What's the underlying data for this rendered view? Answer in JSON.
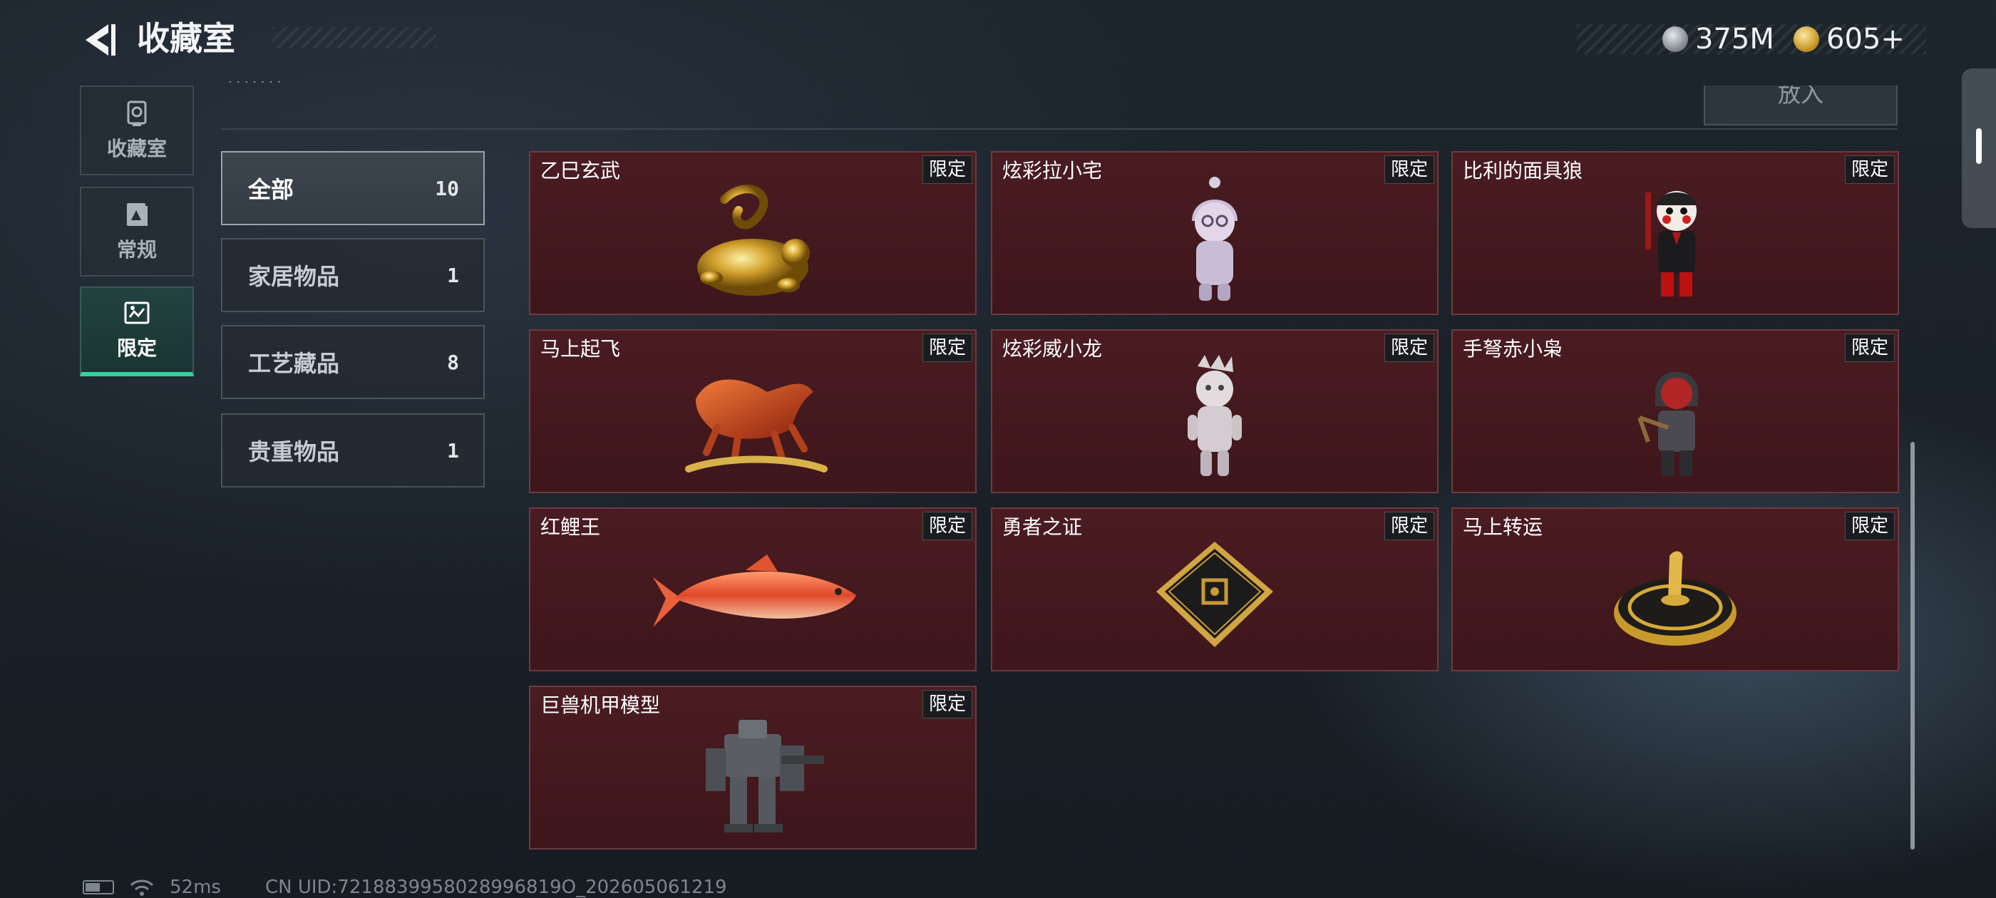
{
  "header": {
    "title": "收藏室",
    "currencies": [
      {
        "icon": "silver-coin-icon",
        "value": "375M",
        "color": "#b9c0c7"
      },
      {
        "icon": "gold-coin-icon",
        "value": "605+",
        "color": "#d6a53a"
      }
    ]
  },
  "nav": [
    {
      "label": "收藏室",
      "icon": "trophy-icon"
    },
    {
      "label": "常规",
      "icon": "document-icon"
    },
    {
      "label": "限定",
      "icon": "limited-icon",
      "active": true
    }
  ],
  "put_button_label": "放入",
  "categories": [
    {
      "label": "全部",
      "count": "10",
      "active": true
    },
    {
      "label": "家居物品",
      "count": "1"
    },
    {
      "label": "工艺藏品",
      "count": "8"
    },
    {
      "label": "贵重物品",
      "count": "1"
    }
  ],
  "items": [
    {
      "name": "乙巳玄武",
      "tag": "限定",
      "icon": "golden-snake-turtle-icon"
    },
    {
      "name": "炫彩拉小宅",
      "tag": "限定",
      "icon": "hooded-doll-figure-icon"
    },
    {
      "name": "比利的面具狼",
      "tag": "限定",
      "icon": "billy-puppet-figure-icon"
    },
    {
      "name": "马上起飞",
      "tag": "限定",
      "icon": "red-horse-statue-icon"
    },
    {
      "name": "炫彩威小龙",
      "tag": "限定",
      "icon": "silver-dragon-doll-icon"
    },
    {
      "name": "手弩赤小枭",
      "tag": "限定",
      "icon": "red-hood-crossbow-figure-icon"
    },
    {
      "name": "红鲤王",
      "tag": "限定",
      "icon": "red-carp-icon"
    },
    {
      "name": "勇者之证",
      "tag": "限定",
      "icon": "black-gold-card-icon"
    },
    {
      "name": "马上转运",
      "tag": "限定",
      "icon": "golden-horse-disc-icon"
    },
    {
      "name": "巨兽机甲模型",
      "tag": "限定",
      "icon": "mech-model-icon"
    }
  ],
  "status": {
    "ping": "52ms",
    "uid": "CN UID:7218839958028996819O_202605061219"
  }
}
